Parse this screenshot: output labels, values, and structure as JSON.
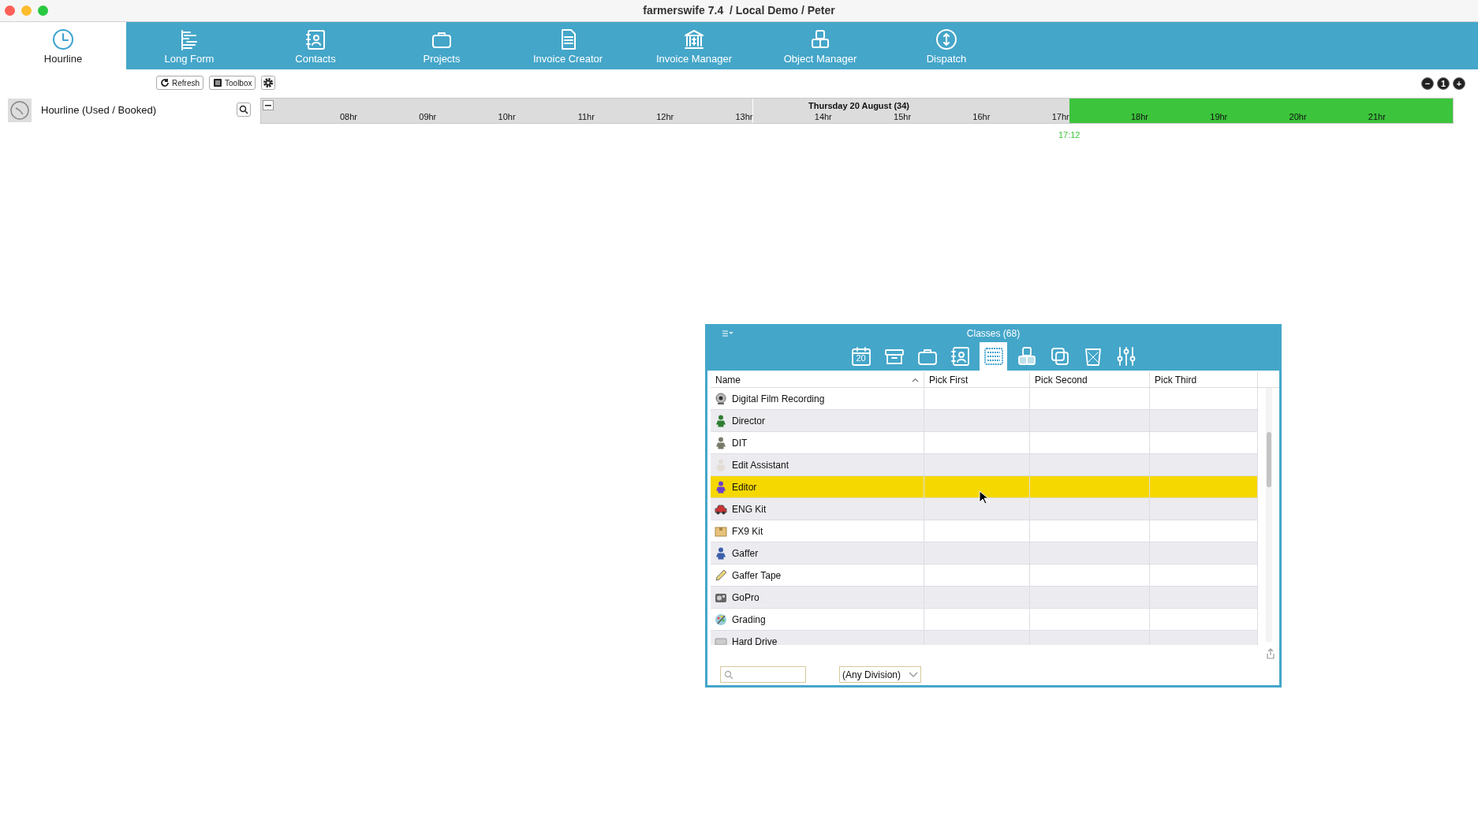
{
  "window": {
    "title": "farmerswife 7.4  / Local Demo / Peter"
  },
  "nav_tabs": [
    {
      "label": "Hourline",
      "selected": true
    },
    {
      "label": "Long Form",
      "selected": false
    },
    {
      "label": "Contacts",
      "selected": false
    },
    {
      "label": "Projects",
      "selected": false
    },
    {
      "label": "Invoice Creator",
      "selected": false
    },
    {
      "label": "Invoice Manager",
      "selected": false
    },
    {
      "label": "Object Manager",
      "selected": false
    },
    {
      "label": "Dispatch",
      "selected": false
    }
  ],
  "toolbar": {
    "buttons": [
      "Refresh",
      "Toolbox"
    ]
  },
  "zoom_buttons": [
    "−",
    "1",
    "+"
  ],
  "hourline": {
    "label": "Hourline (Used / Booked)",
    "date": "Thursday 20 August (34)",
    "now": "17:12",
    "hours": [
      {
        "label": "08hr",
        "future": false
      },
      {
        "label": "09hr",
        "future": false
      },
      {
        "label": "10hr",
        "future": false
      },
      {
        "label": "11hr",
        "future": false
      },
      {
        "label": "12hr",
        "future": false
      },
      {
        "label": "13hr",
        "future": false
      },
      {
        "label": "14hr",
        "future": false
      },
      {
        "label": "15hr",
        "future": false
      },
      {
        "label": "16hr",
        "future": false
      },
      {
        "label": "17hr",
        "future": false
      },
      {
        "label": "18hr",
        "future": true
      },
      {
        "label": "19hr",
        "future": true
      },
      {
        "label": "20hr",
        "future": true
      },
      {
        "label": "21hr",
        "future": true
      }
    ]
  },
  "panel": {
    "title": "Classes (68)",
    "tabs": [
      {
        "label": "20",
        "selected": false
      },
      {
        "selected": false
      },
      {
        "selected": false
      },
      {
        "selected": false
      },
      {
        "selected": true
      },
      {
        "selected": false
      },
      {
        "selected": false
      },
      {
        "selected": false
      },
      {
        "selected": false
      }
    ],
    "columns": [
      "Name",
      "Pick First",
      "Pick Second",
      "Pick Third"
    ],
    "rows": [
      {
        "name": "Digital Film Recording",
        "kind": "webcam",
        "selected": false
      },
      {
        "name": "Director",
        "kind": "person",
        "color": "#2f7d32",
        "selected": false
      },
      {
        "name": "DIT",
        "kind": "person",
        "color": "#7a7a6a",
        "selected": false
      },
      {
        "name": "Edit Assistant",
        "kind": "person",
        "color": "#e2dcd4",
        "selected": false
      },
      {
        "name": "Editor",
        "kind": "person",
        "color": "#6a3fd0",
        "selected": true
      },
      {
        "name": "ENG Kit",
        "kind": "car",
        "selected": false
      },
      {
        "name": "FX9 Kit",
        "kind": "box",
        "selected": false
      },
      {
        "name": "Gaffer",
        "kind": "person",
        "color": "#3b5fa8",
        "selected": false
      },
      {
        "name": "Gaffer Tape",
        "kind": "tape",
        "selected": false
      },
      {
        "name": "GoPro",
        "kind": "camera",
        "selected": false
      },
      {
        "name": "Grading",
        "kind": "palette",
        "selected": false
      },
      {
        "name": "Hard Drive",
        "kind": "drive",
        "selected": false
      }
    ],
    "division": "(Any Division)"
  }
}
